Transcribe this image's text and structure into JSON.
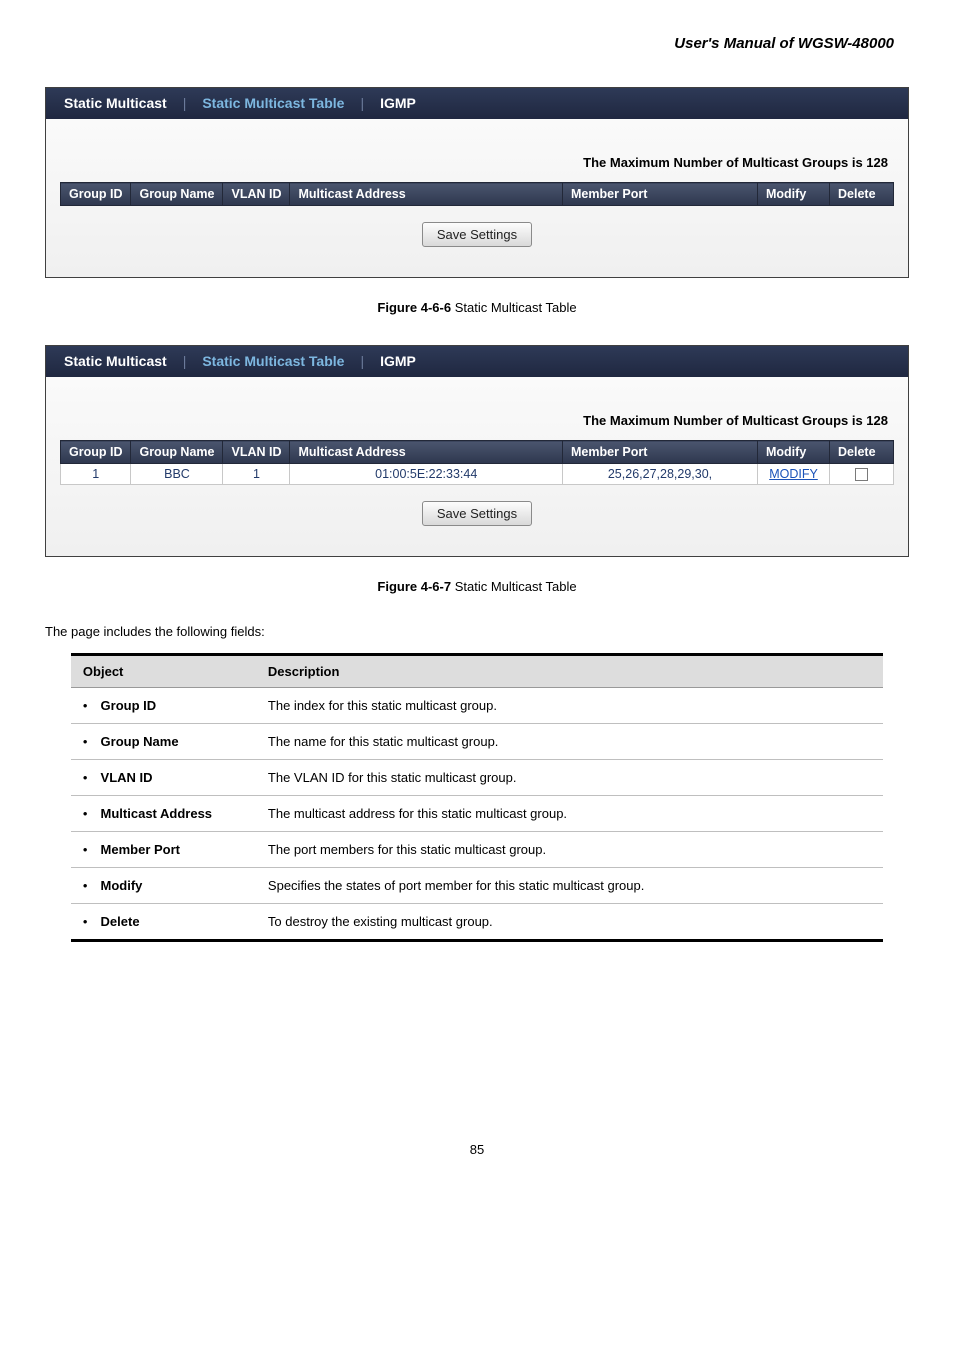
{
  "header": {
    "title": "User's Manual of WGSW-48000"
  },
  "tabs": {
    "t1": "Static Multicast",
    "t2": "Static Multicast Table",
    "t3": "IGMP"
  },
  "max_msg": "The Maximum Number of Multicast Groups is 128",
  "cols": {
    "group_id": "Group ID",
    "group_name": "Group Name",
    "vlan_id": "VLAN ID",
    "multicast_address": "Multicast Address",
    "member_port": "Member Port",
    "modify": "Modify",
    "delete": "Delete"
  },
  "save_label": "Save Settings",
  "row": {
    "group_id": "1",
    "group_name": "BBC",
    "vlan_id": "1",
    "mcast_addr": "01:00:5E:22:33:44",
    "member_port": "25,26,27,28,29,30,",
    "modify": "MODIFY"
  },
  "figcap1_bold": "Figure 4-6-6",
  "figcap1_rest": " Static Multicast Table",
  "figcap2_bold": "Figure 4-6-7",
  "figcap2_rest": " Static Multicast Table",
  "intro": "The page includes the following fields:",
  "fields_header": {
    "object": "Object",
    "description": "Description"
  },
  "fields": [
    {
      "obj": "Group ID",
      "desc": "The index for this static multicast group."
    },
    {
      "obj": "Group Name",
      "desc": "The name for this static multicast group."
    },
    {
      "obj": "VLAN ID",
      "desc": "The VLAN ID for this static multicast group."
    },
    {
      "obj": "Multicast Address",
      "desc": "The multicast address for this static multicast group."
    },
    {
      "obj": "Member Port",
      "desc": "The port members for this static multicast group."
    },
    {
      "obj": "Modify",
      "desc": "Specifies the states of port member for this static multicast group."
    },
    {
      "obj": "Delete",
      "desc": "To destroy the existing multicast group."
    }
  ],
  "page_number": "85"
}
